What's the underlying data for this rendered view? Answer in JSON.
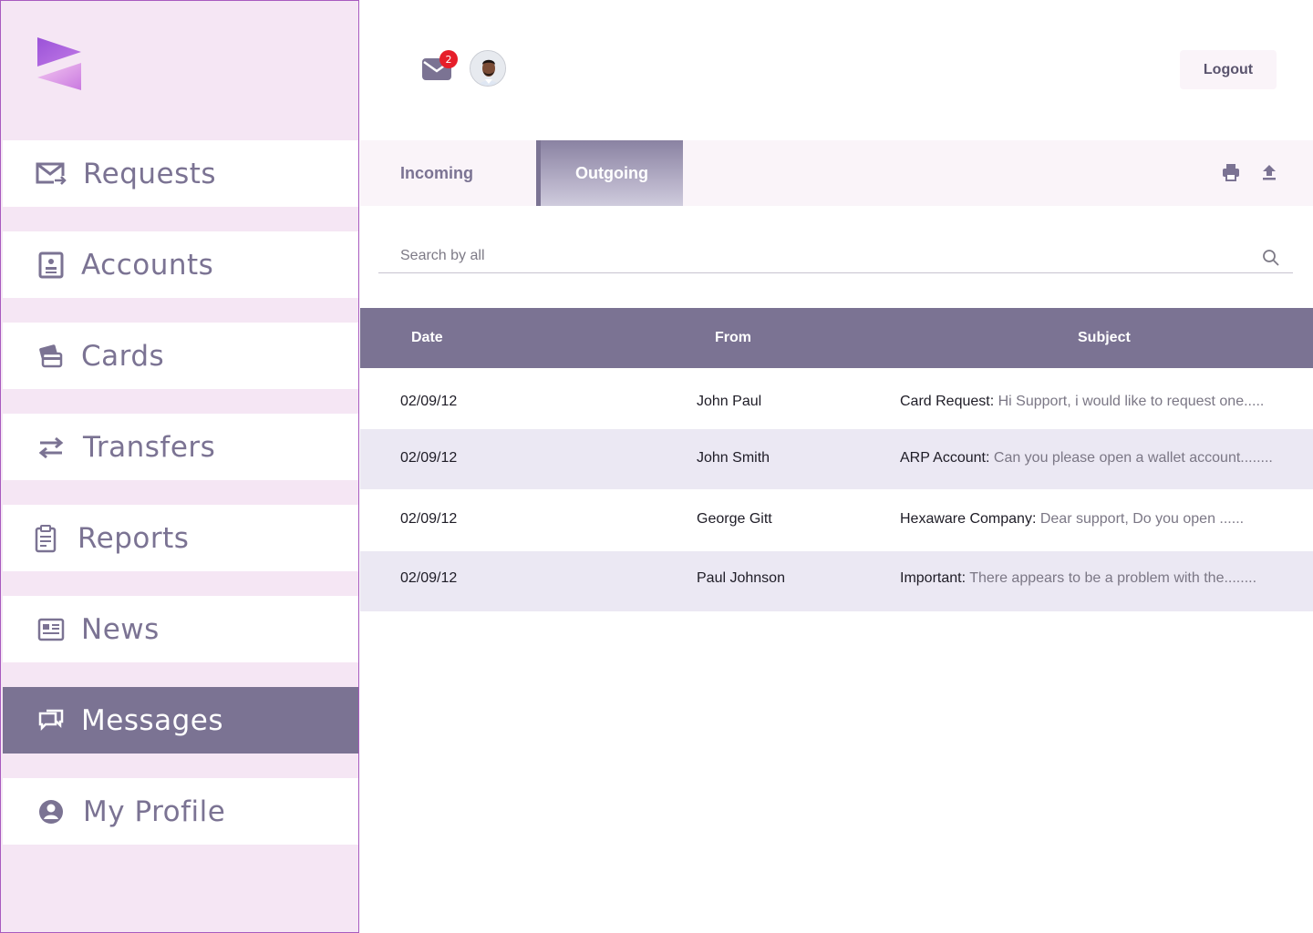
{
  "sidebar": {
    "items": [
      {
        "label": "Requests",
        "icon": "mail-forward-icon"
      },
      {
        "label": "Accounts",
        "icon": "account-card-icon"
      },
      {
        "label": "Cards",
        "icon": "credit-card-icon"
      },
      {
        "label": "Transfers",
        "icon": "swap-arrows-icon"
      },
      {
        "label": "Reports",
        "icon": "clipboard-icon"
      },
      {
        "label": "News",
        "icon": "newspaper-icon"
      },
      {
        "label": "Messages",
        "icon": "chat-bubbles-icon",
        "active": true
      },
      {
        "label": "My Profile",
        "icon": "user-circle-icon"
      }
    ]
  },
  "header": {
    "notification_count": "2",
    "logout_label": "Logout"
  },
  "tabs": {
    "incoming": "Incoming",
    "outgoing": "Outgoing",
    "active": "outgoing"
  },
  "search": {
    "placeholder": "Search by all",
    "value": ""
  },
  "table": {
    "columns": [
      "Date",
      "From",
      "Subject"
    ],
    "rows": [
      {
        "date": "02/09/12",
        "from": "John Paul",
        "subject_prefix": "Card Request:",
        "subject_text": " Hi Support, i would like to request one....."
      },
      {
        "date": "02/09/12",
        "from": "John Smith",
        "subject_prefix": "ARP Account:",
        "subject_text": " Can you please open a wallet account........"
      },
      {
        "date": "02/09/12",
        "from": "George Gitt",
        "subject_prefix": "Hexaware Company:",
        "subject_text": " Dear support, Do you open ......"
      },
      {
        "date": "02/09/12",
        "from": "Paul Johnson",
        "subject_prefix": "Important:",
        "subject_text": " There appears to be a problem with the........"
      }
    ]
  },
  "colors": {
    "accent": "#7b7393",
    "sidebar_bg": "#f5e6f4",
    "badge": "#e61e2a",
    "row_alt": "#ebe8f3"
  }
}
